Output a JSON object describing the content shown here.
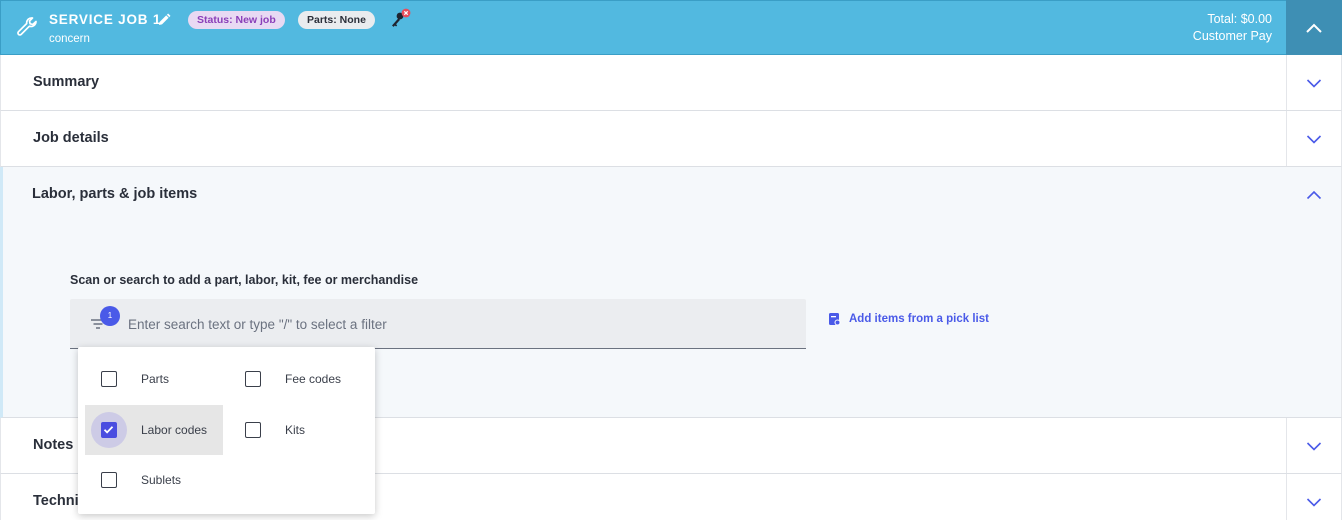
{
  "header": {
    "title": "SERVICE JOB 1",
    "subtitle": "concern",
    "status_badge": "Status: New job",
    "parts_badge": "Parts: None",
    "total": "Total: $0.00",
    "pay_type": "Customer Pay",
    "bg_color": "#52b9e0"
  },
  "sections": {
    "summary": "Summary",
    "job_details": "Job details",
    "labor": "Labor, parts & job items",
    "notes": "Notes",
    "technician": "Techni"
  },
  "labor_panel": {
    "scan_label": "Scan or search to add a part, labor, kit, fee or merchandise",
    "search_placeholder": "Enter search text or type \"/\" to select a filter",
    "search_value": "",
    "filter_count": "1",
    "picklist_label": "Add items from a pick list"
  },
  "filters": {
    "parts": {
      "label": "Parts",
      "checked": false
    },
    "fee_codes": {
      "label": "Fee codes",
      "checked": false
    },
    "labor_codes": {
      "label": "Labor codes",
      "checked": true
    },
    "kits": {
      "label": "Kits",
      "checked": false
    },
    "sublets": {
      "label": "Sublets",
      "checked": false
    }
  },
  "colors": {
    "accent": "#4a5ae8",
    "checkbox_checked": "#4a4de0",
    "header_button": "#3e8fb4"
  }
}
